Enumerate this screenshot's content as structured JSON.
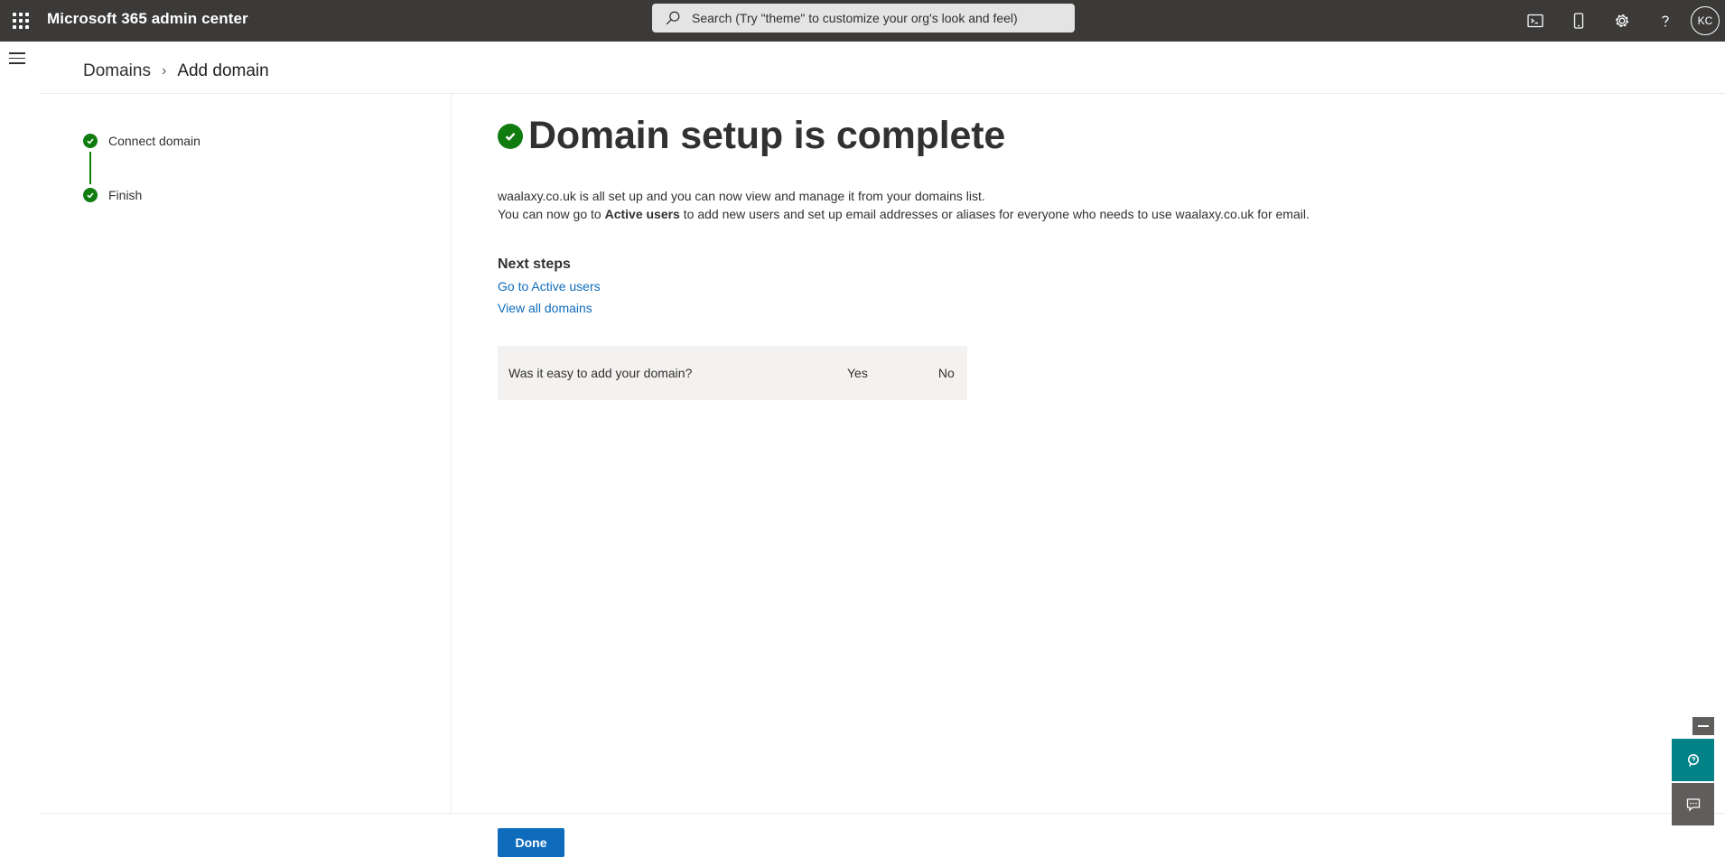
{
  "header": {
    "app_title": "Microsoft 365 admin center",
    "search_placeholder": "Search (Try \"theme\" to customize your org's look and feel)",
    "avatar_initials": "KC",
    "icons": [
      "waffle-icon",
      "terminal-icon",
      "mobile-icon",
      "gear-icon",
      "help-icon"
    ]
  },
  "breadcrumb": {
    "parent": "Domains",
    "current": "Add domain"
  },
  "steps": [
    {
      "label": "Connect domain",
      "status": "complete"
    },
    {
      "label": "Finish",
      "status": "complete"
    }
  ],
  "main": {
    "title": "Domain setup is complete",
    "desc_line1": "waalaxy.co.uk is all set up and you can now view and manage it from your domains list.",
    "desc_line2_prefix": "You can now go to ",
    "desc_line2_bold": "Active users",
    "desc_line2_suffix": " to add new users and set up email addresses or aliases for everyone who needs to use waalaxy.co.uk for email.",
    "next_steps_heading": "Next steps",
    "links": [
      "Go to Active users",
      "View all domains"
    ],
    "feedback": {
      "question": "Was it easy to add your domain?",
      "yes": "Yes",
      "no": "No"
    }
  },
  "footer": {
    "done_label": "Done"
  },
  "colors": {
    "topbar": "#3b3a39",
    "success": "#107c10",
    "link": "#0f6cbd",
    "primary_button": "#0f6cbd",
    "help_fab": "#038387"
  }
}
